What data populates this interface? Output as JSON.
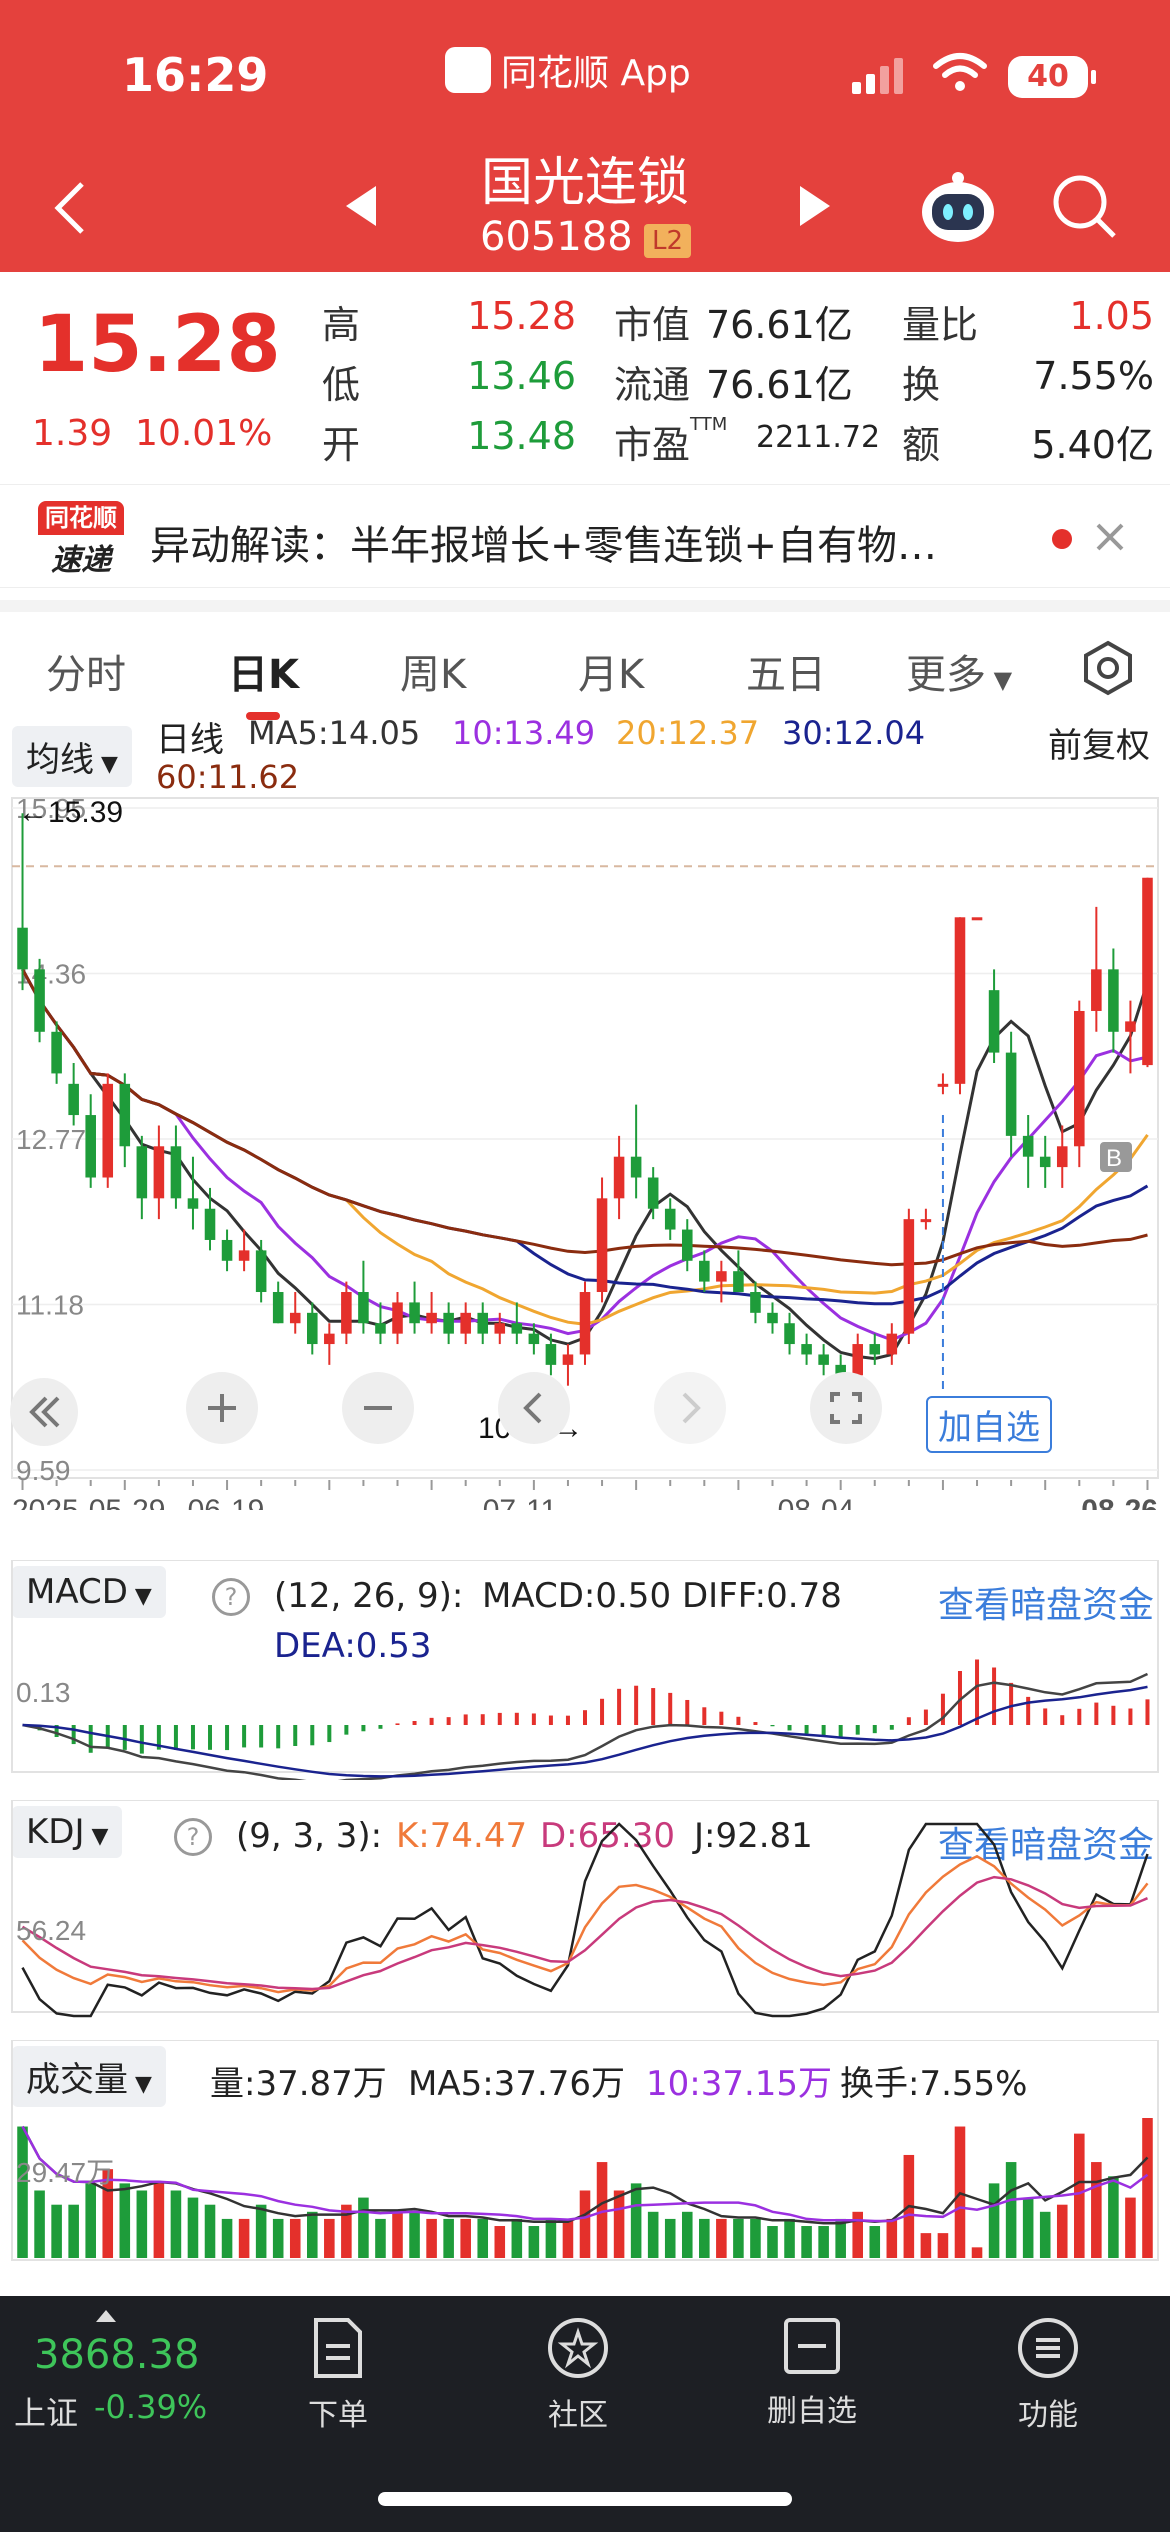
{
  "status_bar": {
    "time": "16:29",
    "app": "同花顺 App",
    "battery": "40"
  },
  "header": {
    "name": "国光连锁",
    "code": "605188",
    "level": "L2"
  },
  "quote": {
    "price": "15.28",
    "change": "1.39",
    "change_pct": "10.01%",
    "high_label": "高",
    "high": "15.28",
    "low_label": "低",
    "low": "13.46",
    "open_label": "开",
    "open": "13.48",
    "mcap_label": "市值",
    "mcap": "76.61亿",
    "float_label": "流通",
    "float": "76.61亿",
    "pe_label": "市盈",
    "pe_sup": "TTM",
    "pe": "2211.72",
    "vr_label": "量比",
    "vr": "1.05",
    "turn_label": "换",
    "turn": "7.55%",
    "amt_label": "额",
    "amt": "5.40亿"
  },
  "news": {
    "badge_top": "同花顺",
    "badge_bottom": "速递",
    "text": "异动解读：半年报增长+零售连锁+自有物…"
  },
  "tabs": [
    "分时",
    "日K",
    "周K",
    "月K",
    "五日",
    "更多"
  ],
  "kline": {
    "indicator_label": "均线",
    "period": "日线",
    "ma5": "MA5:14.05",
    "ma10": "10:13.49",
    "ma20": "20:12.37",
    "ma30": "30:12.04",
    "ma60": "60:11.62",
    "adjust": "前复权",
    "high_marker": "←15.39",
    "low_marker": "10.30→",
    "y_ticks": [
      "15.95",
      "14.36",
      "12.77",
      "11.18",
      "9.59"
    ],
    "dates": [
      "2025-05-29",
      "06-19",
      "07-11",
      "08-04",
      "08-26"
    ],
    "add_watch": "加自选",
    "b_marker": "B"
  },
  "macd": {
    "label": "MACD",
    "params": "(12, 26, 9):",
    "macd": "MACD:0.50",
    "diff": "DIFF:0.78",
    "dea": "DEA:0.53",
    "ytick": "0.13",
    "link": "查看暗盘资金"
  },
  "kdj": {
    "label": "KDJ",
    "params": "(9, 3, 3):",
    "k": "K:74.47",
    "d": "D:65.30",
    "j": "J:92.81",
    "ytick": "56.24",
    "link": "查看暗盘资金"
  },
  "vol": {
    "label": "成交量",
    "vol": "量:37.87万",
    "ma5": "MA5:37.76万",
    "ma10": "10:37.15万",
    "turn": "换手:7.55%",
    "ytick": "29.47万"
  },
  "bottom": {
    "index_value": "3868.38",
    "index_name": "上证",
    "index_chg": "-0.39%",
    "items": [
      "下单",
      "社区",
      "删自选",
      "功能"
    ]
  },
  "colors": {
    "header": "#e4413d",
    "up": "#e4302b",
    "down": "#1e9c3a",
    "ma5": "#333333",
    "ma10": "#9b30e0",
    "ma20": "#f0a630",
    "ma30": "#1a238f",
    "ma60": "#8a2c0f"
  },
  "chart_data": {
    "type": "candlestick",
    "title": "",
    "candles": [
      [
        14.8,
        15.9,
        14.2,
        14.4
      ],
      [
        14.4,
        14.5,
        13.7,
        13.8
      ],
      [
        13.8,
        13.9,
        13.3,
        13.4
      ],
      [
        13.3,
        13.5,
        12.9,
        13.0
      ],
      [
        13.0,
        13.2,
        12.3,
        12.4
      ],
      [
        12.4,
        13.4,
        12.3,
        13.3
      ],
      [
        13.3,
        13.4,
        12.5,
        12.7
      ],
      [
        12.7,
        12.8,
        12.0,
        12.2
      ],
      [
        12.2,
        12.9,
        12.0,
        12.7
      ],
      [
        12.7,
        12.9,
        12.1,
        12.2
      ],
      [
        12.2,
        12.6,
        11.9,
        12.1
      ],
      [
        12.1,
        12.3,
        11.7,
        11.8
      ],
      [
        11.8,
        11.9,
        11.5,
        11.6
      ],
      [
        11.6,
        11.9,
        11.5,
        11.7
      ],
      [
        11.7,
        11.8,
        11.2,
        11.3
      ],
      [
        11.3,
        11.4,
        11.0,
        11.0
      ],
      [
        11.0,
        11.3,
        10.9,
        11.1
      ],
      [
        11.1,
        11.2,
        10.7,
        10.8
      ],
      [
        10.8,
        11.0,
        10.6,
        10.9
      ],
      [
        10.9,
        11.4,
        10.8,
        11.3
      ],
      [
        11.3,
        11.6,
        10.9,
        11.0
      ],
      [
        11.0,
        11.2,
        10.8,
        10.9
      ],
      [
        10.9,
        11.3,
        10.8,
        11.2
      ],
      [
        11.2,
        11.4,
        10.9,
        11.0
      ],
      [
        11.0,
        11.3,
        10.9,
        11.1
      ],
      [
        11.1,
        11.2,
        10.8,
        10.9
      ],
      [
        10.9,
        11.2,
        10.8,
        11.1
      ],
      [
        11.1,
        11.2,
        10.8,
        10.9
      ],
      [
        10.9,
        11.1,
        10.8,
        11.0
      ],
      [
        11.0,
        11.2,
        10.8,
        10.9
      ],
      [
        10.9,
        11.0,
        10.7,
        10.8
      ],
      [
        10.8,
        10.9,
        10.5,
        10.6
      ],
      [
        10.6,
        10.8,
        10.4,
        10.7
      ],
      [
        10.7,
        11.4,
        10.6,
        11.3
      ],
      [
        11.3,
        12.4,
        11.2,
        12.2
      ],
      [
        12.2,
        12.8,
        12.0,
        12.6
      ],
      [
        12.6,
        13.1,
        12.2,
        12.4
      ],
      [
        12.4,
        12.5,
        12.0,
        12.1
      ],
      [
        12.1,
        12.2,
        11.8,
        11.9
      ],
      [
        11.9,
        12.0,
        11.5,
        11.6
      ],
      [
        11.6,
        11.7,
        11.3,
        11.4
      ],
      [
        11.4,
        11.6,
        11.2,
        11.5
      ],
      [
        11.5,
        11.7,
        11.3,
        11.3
      ],
      [
        11.3,
        11.4,
        11.0,
        11.1
      ],
      [
        11.1,
        11.2,
        10.9,
        11.0
      ],
      [
        11.0,
        11.1,
        10.7,
        10.8
      ],
      [
        10.8,
        10.9,
        10.6,
        10.7
      ],
      [
        10.7,
        10.8,
        10.5,
        10.6
      ],
      [
        10.6,
        10.7,
        10.3,
        10.5
      ],
      [
        10.5,
        10.9,
        10.4,
        10.8
      ],
      [
        10.8,
        10.9,
        10.6,
        10.7
      ],
      [
        10.7,
        11.0,
        10.6,
        10.9
      ],
      [
        10.9,
        12.1,
        10.8,
        12.0
      ],
      [
        12.0,
        12.1,
        11.9,
        12.0
      ],
      [
        13.3,
        13.4,
        13.2,
        13.3
      ],
      [
        13.3,
        14.9,
        13.2,
        14.9
      ],
      [
        14.9,
        14.9,
        14.9,
        14.9
      ],
      [
        14.2,
        14.4,
        13.5,
        13.6
      ],
      [
        13.6,
        13.8,
        12.6,
        12.8
      ],
      [
        12.8,
        13.0,
        12.3,
        12.6
      ],
      [
        12.6,
        12.8,
        12.3,
        12.5
      ],
      [
        12.5,
        12.9,
        12.3,
        12.7
      ],
      [
        12.7,
        14.1,
        12.5,
        14.0
      ],
      [
        14.0,
        15.0,
        13.8,
        14.4
      ],
      [
        14.4,
        14.6,
        13.6,
        13.8
      ],
      [
        13.8,
        14.1,
        13.4,
        13.9
      ],
      [
        13.48,
        15.28,
        13.46,
        15.28
      ]
    ],
    "volume_ytick": "29.47万"
  }
}
